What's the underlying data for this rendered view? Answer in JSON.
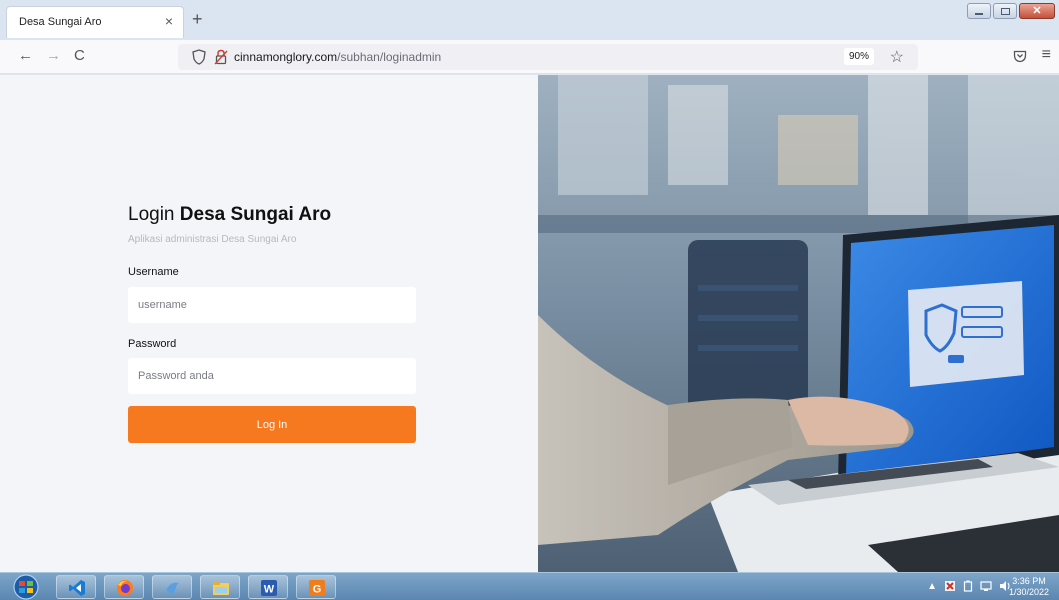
{
  "browser": {
    "tab_title": "Desa Sungai Aro",
    "tab_close": "×",
    "new_tab": "+",
    "url_domain": "cinnamonglory.com",
    "url_path": "/subhan/loginadmin",
    "zoom": "90%",
    "back": "←",
    "forward": "→",
    "reload": "C",
    "bookmark": "☆",
    "menu": "≡"
  },
  "login": {
    "title_prefix": "Login",
    "title_name": "Desa Sungai Aro",
    "subtitle": "Aplikasi administrasi Desa Sungai Aro",
    "username_label": "Username",
    "username_placeholder": "username",
    "password_label": "Password",
    "password_placeholder": "Password anda",
    "button_label": "Log In",
    "accent_color": "#f6791f"
  },
  "taskbar": {
    "items": [
      "windows-start",
      "vscode",
      "firefox",
      "dolphin",
      "file-explorer",
      "word",
      "foxit-pdf"
    ],
    "clock_time": "3:36 PM",
    "clock_date": "1/30/2022",
    "tray_arrow": "▲"
  }
}
